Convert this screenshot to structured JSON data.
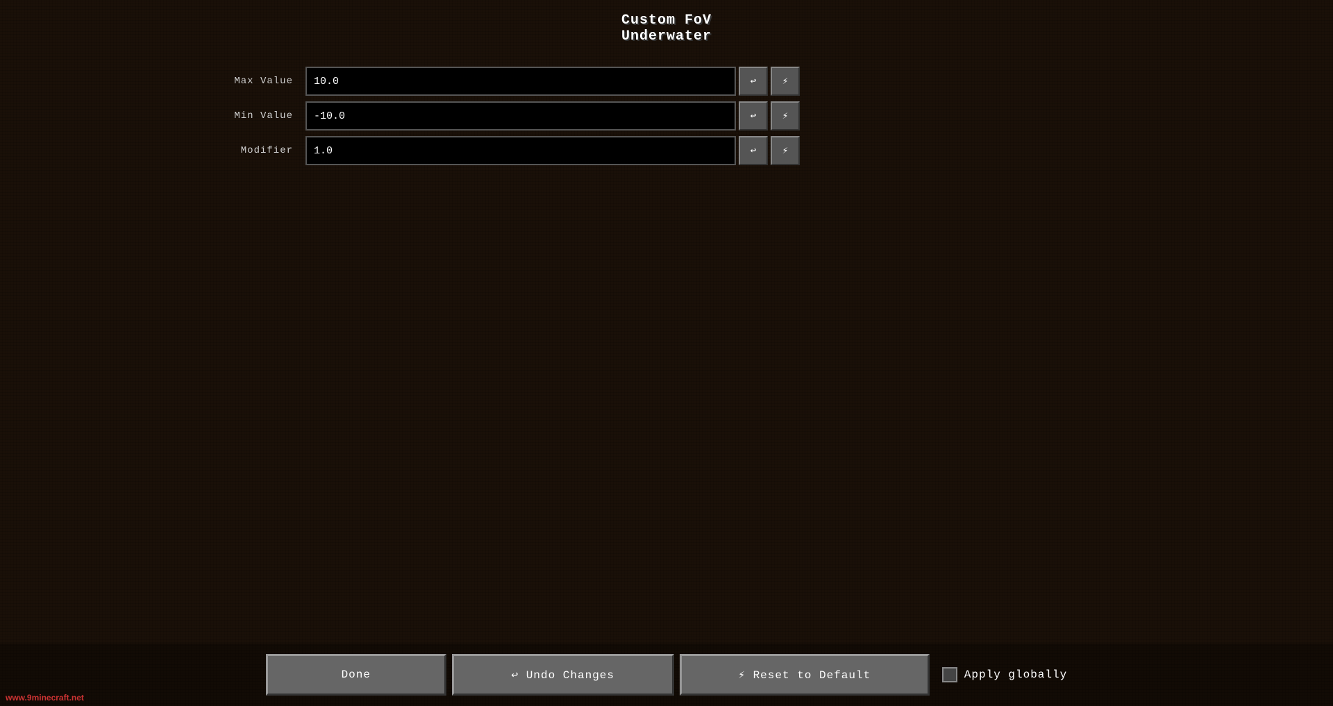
{
  "title": {
    "line1": "Custom FoV",
    "line2": "Underwater"
  },
  "fields": [
    {
      "label": "Max Value",
      "value": "10.0",
      "id": "max-value"
    },
    {
      "label": "Min Value",
      "value": "-10.0",
      "id": "min-value"
    },
    {
      "label": "Modifier",
      "value": "1.0",
      "id": "modifier"
    }
  ],
  "buttons": {
    "undo_field": "↩",
    "reset_field": "⚡",
    "done": "Done",
    "undo_changes": "↩ Undo Changes",
    "reset_to_default": "⚡ Reset to Default",
    "apply_globally": "Apply globally"
  },
  "watermark": "www.9minecraft.net"
}
